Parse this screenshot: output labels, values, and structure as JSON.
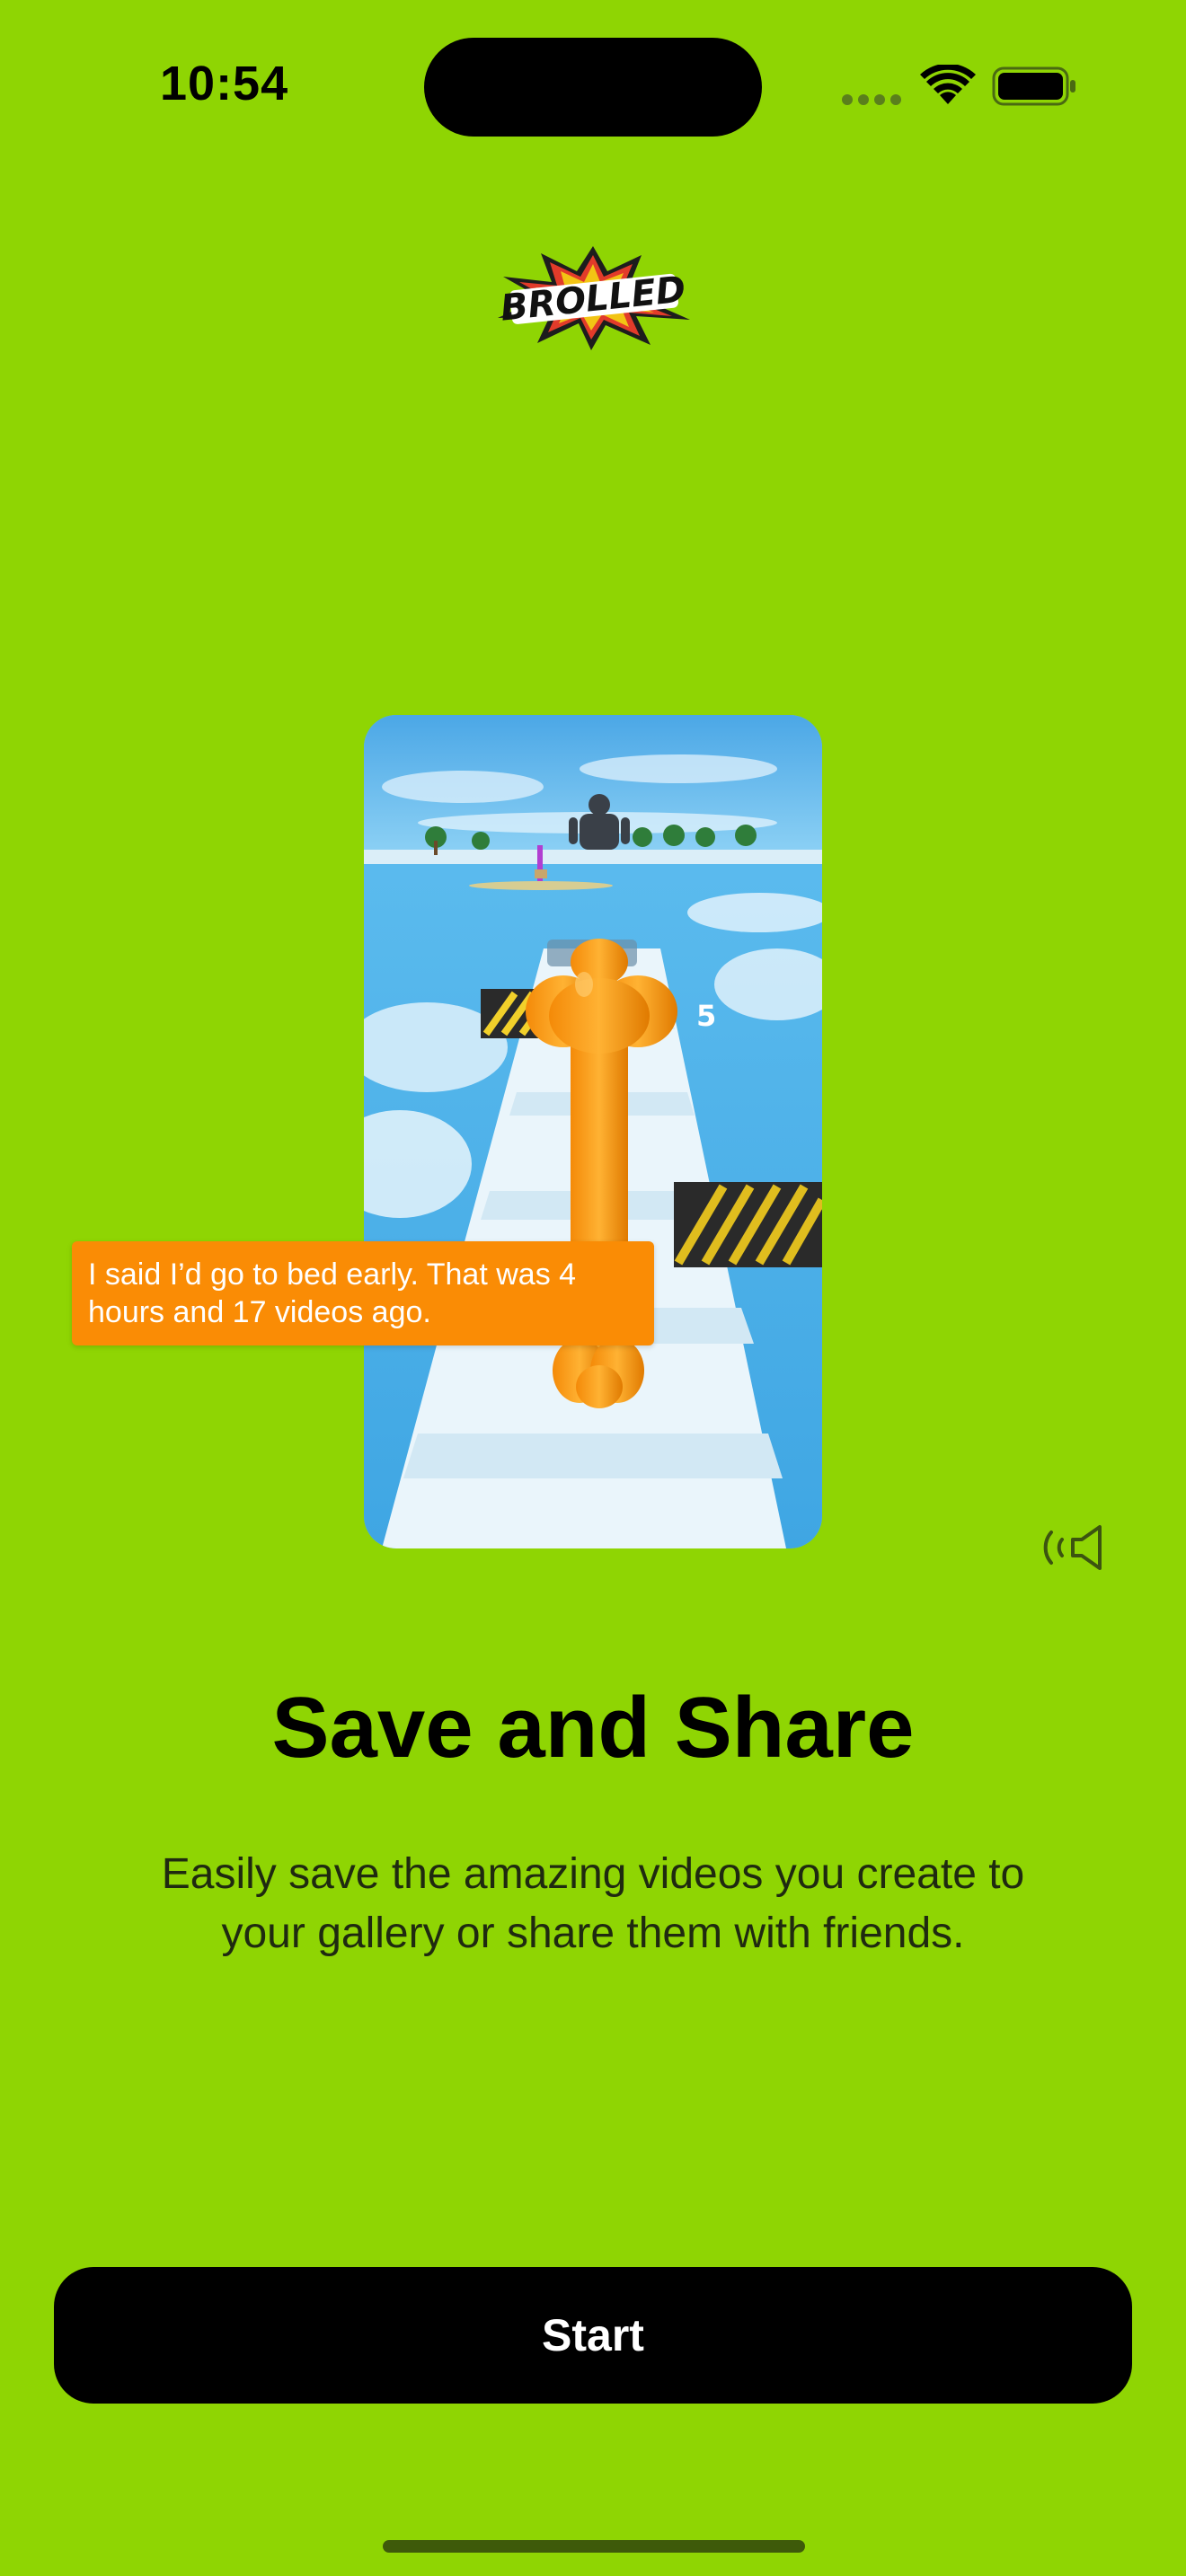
{
  "status_bar": {
    "time": "10:54",
    "icons": [
      "cellular-signal-icon",
      "wifi-icon",
      "battery-icon"
    ]
  },
  "logo": {
    "text": "BROLLED"
  },
  "video": {
    "caption": "I said I’d go to bed early. That was 4 hours and 17 videos ago.",
    "overlay_number": "5"
  },
  "sound_icon": "speaker-icon",
  "onboarding": {
    "title": "Save and Share",
    "description": "Easily save the amazing videos you create to your gallery or share them with friends."
  },
  "start_button": {
    "label": "Start"
  },
  "colors": {
    "background": "#8fd503",
    "caption_background": "#fa8c05",
    "button_background": "#000000"
  }
}
